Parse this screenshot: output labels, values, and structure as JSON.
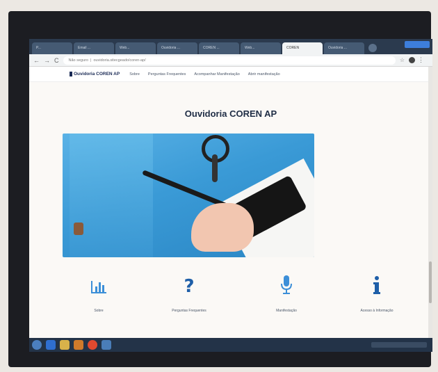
{
  "browser": {
    "tabs": [
      {
        "label": "P..."
      },
      {
        "label": "Email ..."
      },
      {
        "label": "Web..."
      },
      {
        "label": "Ouvidoria ..."
      },
      {
        "label": "COREN ..."
      },
      {
        "label": "Web..."
      },
      {
        "label": "COREN"
      },
      {
        "label": "Ouvidoria ..."
      }
    ],
    "active_tab_index": 6,
    "address": {
      "security_label": "Não seguro",
      "url": "ouvidoria.sitecgeado/coren-ap/"
    }
  },
  "site": {
    "brand": "Ouvidoria COREN AP",
    "nav": [
      "Sobre",
      "Perguntas Frequentes",
      "Acompanhar Manifestação",
      "Abrir manifestação"
    ],
    "title": "Ouvidoria COREN AP"
  },
  "features": [
    {
      "icon": "bar-chart-icon",
      "label": "Sobre"
    },
    {
      "icon": "question-mark-icon",
      "label": "Perguntas Frequentes"
    },
    {
      "icon": "microphone-icon",
      "label": "Manifestação"
    },
    {
      "icon": "info-icon",
      "label": "Acesso à Informação"
    }
  ],
  "colors": {
    "accent": "#3c8fd8",
    "brand": "#1a2a55",
    "hero_blue": "#3a9ad6"
  }
}
